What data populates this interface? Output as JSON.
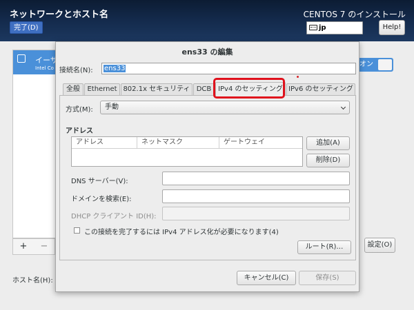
{
  "header": {
    "title": "ネットワークとホスト名",
    "done_label": "完了(D)",
    "install_title": "CENTOS 7 のインストール",
    "keyboard_layout": "jp",
    "help_label": "Help!"
  },
  "background": {
    "device_name": "イーサ",
    "device_sub": "Intel Co",
    "add_label": "+",
    "remove_label": "−",
    "toggle_label": "オン",
    "settings_label": "設定(O)",
    "hostname_label": "ホスト名(H):"
  },
  "dialog": {
    "title": "ens33 の編集",
    "connection_label": "接続名(N):",
    "connection_value": "ens33",
    "tabs": [
      {
        "label": "全般"
      },
      {
        "label": "Ethernet"
      },
      {
        "label": "802.1x セキュリティ"
      },
      {
        "label": "DCB"
      },
      {
        "label": "IPv4 のセッティング"
      },
      {
        "label": "IPv6 のセッティング"
      }
    ],
    "active_tab": "IPv4 のセッティング",
    "method_label": "方式(M):",
    "method_value": "手動",
    "address_title": "アドレス",
    "address_columns": [
      "アドレス",
      "ネットマスク",
      "ゲートウェイ"
    ],
    "add_button": "追加(A)",
    "delete_button": "削除(D)",
    "dns_label": "DNS サーバー(V):",
    "search_domain_label": "ドメインを検索(E):",
    "dhcp_client_label": "DHCP クライアント ID(H):",
    "require_ipv4_label": "この接続を完了するには IPv4 アドレス化が必要になります(4)",
    "routes_button": "ルート(R)…",
    "cancel_button": "キャンセル(C)",
    "save_button": "保存(S)"
  },
  "colors": {
    "header_bg": "#13294a",
    "accent": "#4a90d9",
    "highlight": "#e0111c"
  }
}
